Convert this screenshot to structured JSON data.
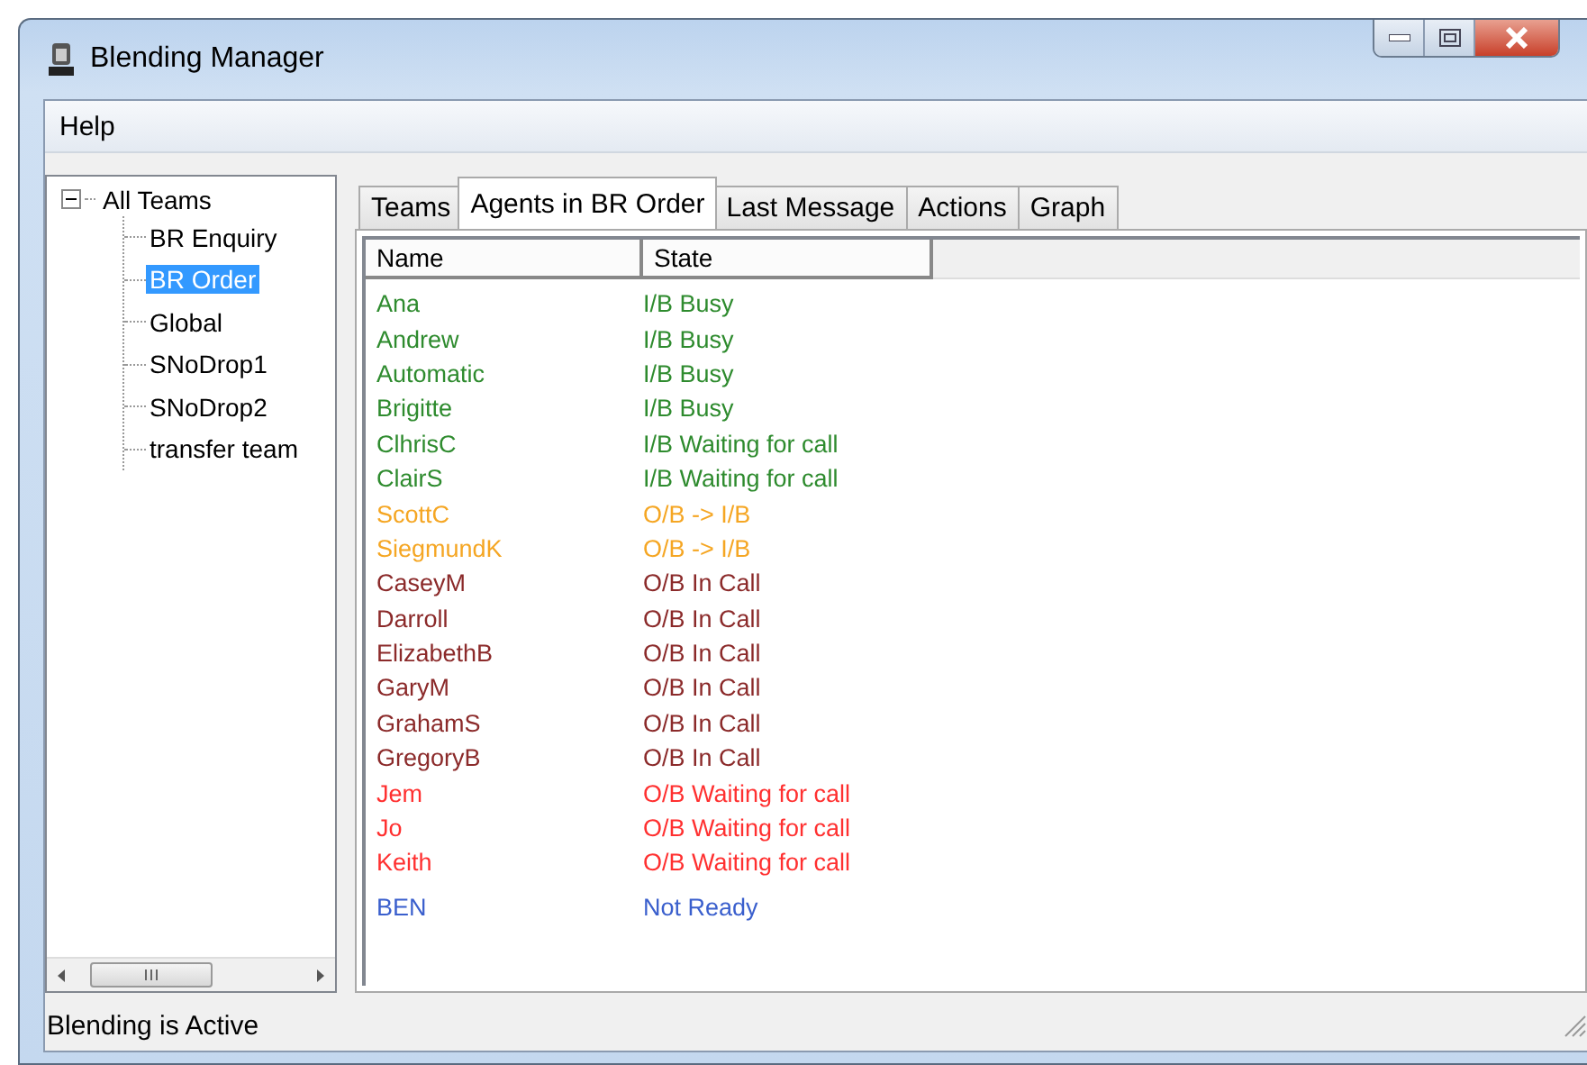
{
  "window": {
    "title": "Blending Manager"
  },
  "menu": [
    "Help"
  ],
  "tree": {
    "label": "All Teams",
    "expanded": true,
    "children": [
      {
        "label": "BR Enquiry",
        "selected": false
      },
      {
        "label": "BR Order",
        "selected": true
      },
      {
        "label": "Global",
        "selected": false
      },
      {
        "label": "SNoDrop1",
        "selected": false
      },
      {
        "label": "SNoDrop2",
        "selected": false
      },
      {
        "label": "transfer team",
        "selected": false
      }
    ]
  },
  "tabs": [
    {
      "label": "Teams",
      "selected": false
    },
    {
      "label": "Agents in BR Order",
      "selected": true
    },
    {
      "label": "Last Message",
      "selected": false
    },
    {
      "label": "Actions",
      "selected": false
    },
    {
      "label": "Graph",
      "selected": false
    }
  ],
  "table": {
    "columns": [
      "Name",
      "State"
    ],
    "rows": [
      {
        "name": "Ana",
        "state": "I/B Busy",
        "color": "#2e8b2e"
      },
      {
        "name": "Andrew",
        "state": "I/B Busy",
        "color": "#2e8b2e"
      },
      {
        "name": "Automatic",
        "state": "I/B Busy",
        "color": "#2e8b2e"
      },
      {
        "name": "Brigitte",
        "state": "I/B Busy",
        "color": "#2e8b2e"
      },
      {
        "name": "ClhrisC",
        "state": "I/B Waiting for call",
        "color": "#2e8b2e"
      },
      {
        "name": "ClairS",
        "state": "I/B Waiting for call",
        "color": "#2e8b2e"
      },
      {
        "name": "ScottC",
        "state": "O/B -> I/B",
        "color": "#f5a623"
      },
      {
        "name": "SiegmundK",
        "state": "O/B -> I/B",
        "color": "#f5a623"
      },
      {
        "name": "CaseyM",
        "state": "O/B In Call",
        "color": "#8b2a2a"
      },
      {
        "name": "Darroll",
        "state": "O/B In Call",
        "color": "#8b2a2a"
      },
      {
        "name": "ElizabethB",
        "state": "O/B In Call",
        "color": "#8b2a2a"
      },
      {
        "name": "GaryM",
        "state": "O/B In Call",
        "color": "#8b2a2a"
      },
      {
        "name": "GrahamS",
        "state": "O/B In Call",
        "color": "#8b2a2a"
      },
      {
        "name": "GregoryB",
        "state": "O/B In Call",
        "color": "#8b2a2a"
      },
      {
        "name": "Jem",
        "state": "O/B Waiting for call",
        "color": "#ff3030"
      },
      {
        "name": "Jo",
        "state": "O/B Waiting for call",
        "color": "#ff3030"
      },
      {
        "name": "Keith",
        "state": "O/B Waiting for call",
        "color": "#ff3030"
      },
      {
        "name": "BEN",
        "state": "Not Ready",
        "color": "#3a5fcd"
      }
    ]
  },
  "status_bar": "Blending is Active"
}
